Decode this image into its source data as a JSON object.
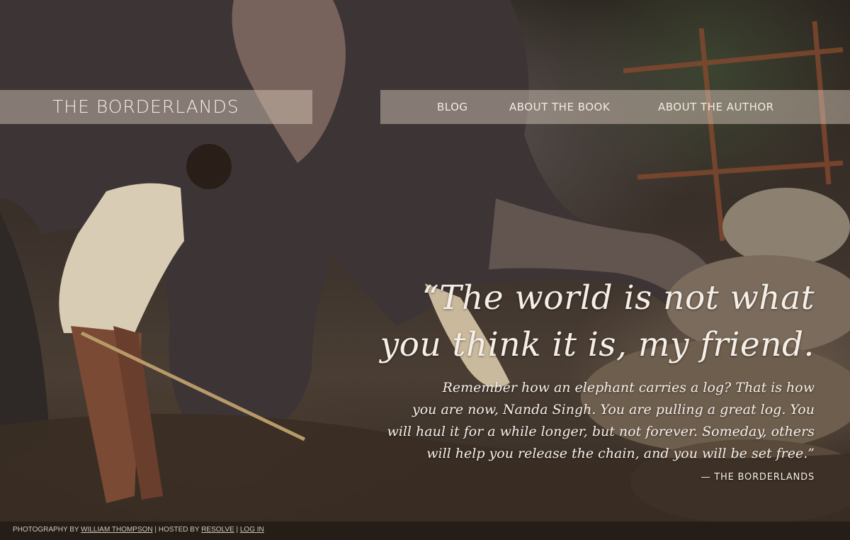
{
  "header": {
    "brand": "THE BORDERLANDS",
    "nav": {
      "blog": "BLOG",
      "about_book": "ABOUT THE BOOK",
      "about_author": "ABOUT THE AUTHOR"
    }
  },
  "quote": {
    "headline_line1": "“The world is not what",
    "headline_line2": "you think it is, my friend.",
    "body_line1": "Remember how an elephant carries a log? That is how",
    "body_line2": "you are now, Nanda Singh. You are pulling a great log. You",
    "body_line3": "will haul it for a while longer, but not forever. Someday, others",
    "body_line4": "will help you release the chain, and you will be set free.”",
    "attribution": "— THE BORDERLANDS"
  },
  "footer": {
    "photo_prefix": "PHOTOGRAPHY BY ",
    "photographer": "WILLIAM THOMPSON",
    "hosted_prefix": " | HOSTED BY ",
    "host": "RESOLVE",
    "separator": " | ",
    "login": "LOG IN"
  },
  "colors": {
    "nav_overlay": "#d7c8b9",
    "text_light": "#f5efe8",
    "footer_bg": "#16120f"
  }
}
